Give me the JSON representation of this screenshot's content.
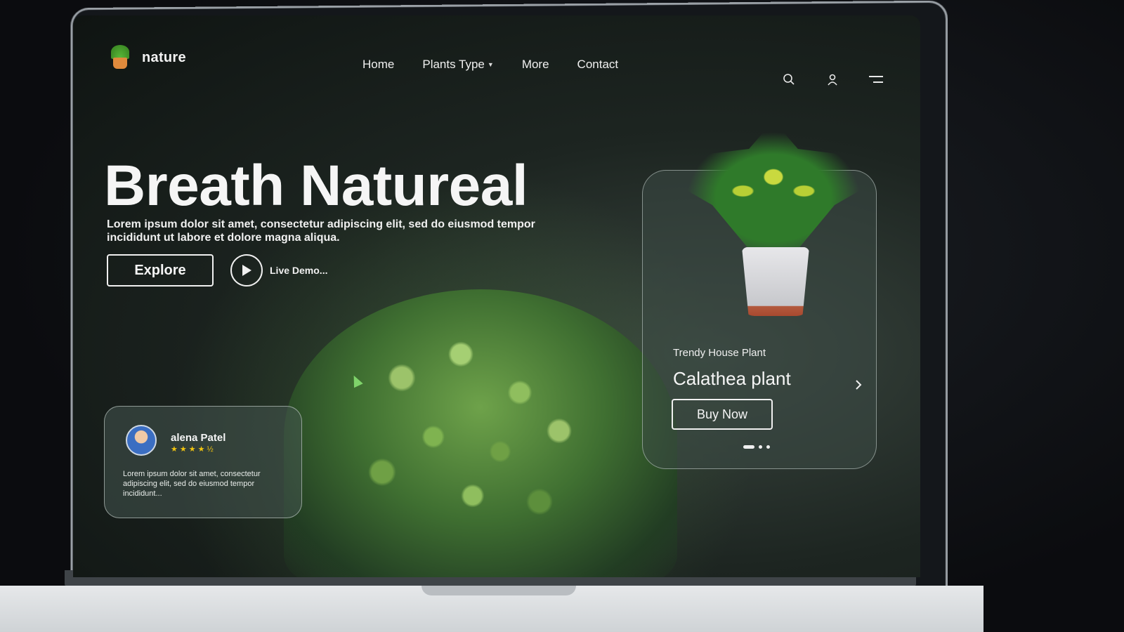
{
  "brand": {
    "name": "nature",
    "logo_icon": "potted-plant-logo-icon"
  },
  "nav": {
    "items": [
      {
        "label": "Home"
      },
      {
        "label": "Plants Type",
        "has_dropdown": true
      },
      {
        "label": "More"
      },
      {
        "label": "Contact"
      }
    ],
    "icons": [
      "search-icon",
      "user-icon",
      "menu-icon"
    ]
  },
  "hero": {
    "title": "Breath Natureal",
    "description": "Lorem ipsum dolor sit amet, consectetur adipiscing elit, sed do eiusmod tempor incididunt ut labore et dolore magna aliqua.",
    "explore_label": "Explore",
    "demo_label": "Live Demo..."
  },
  "review": {
    "name": "alena Patel",
    "rating": 4.5,
    "stars": "★★★★½",
    "text": "Lorem ipsum dolor sit amet, consectetur adipiscing elit, sed do eiusmod tempor incididunt..."
  },
  "product": {
    "kicker": "Trendy House Plant",
    "name": "Calathea plant",
    "buy_label": "Buy Now",
    "slides_total": 3,
    "slide_active": 1
  },
  "colors": {
    "accent_text": "#f5f5f5",
    "star": "#f1c40f",
    "background": "#1d2521"
  }
}
